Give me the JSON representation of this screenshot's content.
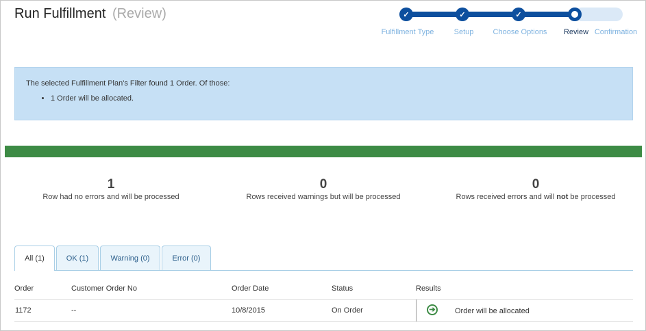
{
  "page": {
    "title": "Run Fulfillment",
    "subtitle": "(Review)"
  },
  "wizard": {
    "steps": [
      {
        "label": "Fulfillment Type",
        "state": "done"
      },
      {
        "label": "Setup",
        "state": "done"
      },
      {
        "label": "Choose Options",
        "state": "done"
      },
      {
        "label": "Review",
        "state": "current"
      },
      {
        "label": "Confirmation",
        "state": "upcoming"
      }
    ],
    "check_glyph": "✓"
  },
  "info": {
    "message": "The selected Fulfillment Plan's Filter found 1 Order. Of those:",
    "bullets": [
      "1 Order will be allocated."
    ]
  },
  "progress": {
    "percent": 100,
    "color": "#3d8b45"
  },
  "stats": [
    {
      "value": "1",
      "label": "Row had no errors and will be processed"
    },
    {
      "value": "0",
      "label": "Rows received warnings but will be processed"
    },
    {
      "value": "0",
      "label_before": "Rows received errors and will ",
      "label_bold": "not",
      "label_after": " be processed"
    }
  ],
  "tabs": [
    {
      "label": "All (1)",
      "active": true
    },
    {
      "label": "OK (1)",
      "active": false
    },
    {
      "label": "Warning (0)",
      "active": false
    },
    {
      "label": "Error (0)",
      "active": false
    }
  ],
  "table": {
    "columns": [
      "Order",
      "Customer Order No",
      "Order Date",
      "Status",
      "Results"
    ],
    "rows": [
      {
        "order": "1172",
        "customer_order_no": "--",
        "order_date": "10/8/2015",
        "status": "On Order",
        "results_icon": "arrow-right-circle-icon",
        "results_glyph": "➔",
        "results": "Order will be allocated"
      }
    ]
  }
}
